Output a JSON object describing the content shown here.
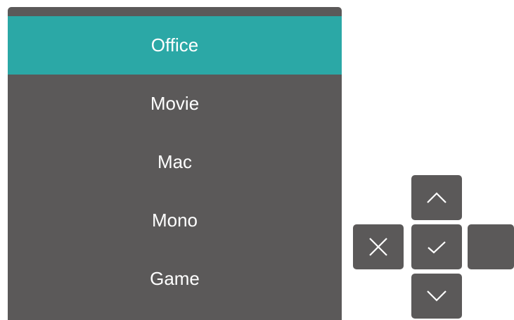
{
  "menu": {
    "items": [
      {
        "label": "Office",
        "selected": true
      },
      {
        "label": "Movie",
        "selected": false
      },
      {
        "label": "Mac",
        "selected": false
      },
      {
        "label": "Mono",
        "selected": false
      },
      {
        "label": "Game",
        "selected": false
      }
    ]
  },
  "controls": {
    "up_icon": "chevron-up-icon",
    "down_icon": "chevron-down-icon",
    "close_icon": "close-icon",
    "confirm_icon": "checkmark-icon",
    "right_icon": "blank"
  },
  "colors": {
    "panel": "#5b5959",
    "selected": "#2ba8a6",
    "text": "#ffffff"
  }
}
